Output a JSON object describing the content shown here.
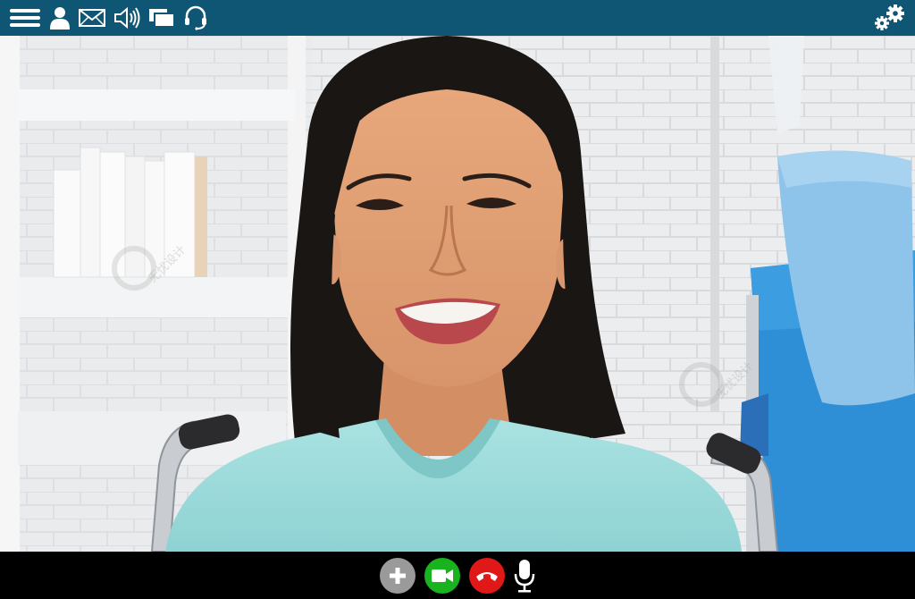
{
  "app": {
    "accent_color": "#0e5673",
    "toolbar_icons": [
      "menu-icon",
      "user-icon",
      "mail-icon",
      "speaker-icon",
      "screens-icon",
      "headset-icon"
    ],
    "settings_icon": "gears-icon"
  },
  "video": {
    "watermark": "无忧设计"
  },
  "controls": [
    {
      "name": "add-participant-button",
      "icon": "plus-icon",
      "color": "#9a9a9a"
    },
    {
      "name": "video-toggle-button",
      "icon": "camera-icon",
      "color": "#18b31e"
    },
    {
      "name": "end-call-button",
      "icon": "hangup-icon",
      "color": "#e01818"
    },
    {
      "name": "microphone-button",
      "icon": "microphone-icon",
      "color": "transparent"
    }
  ]
}
